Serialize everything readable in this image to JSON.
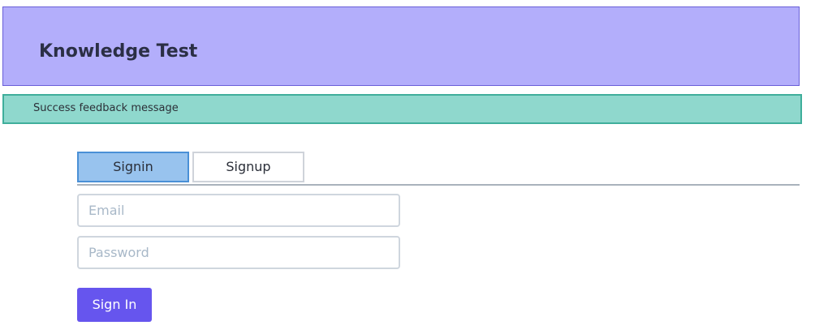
{
  "header": {
    "title": "Knowledge Test"
  },
  "alert": {
    "message": "Success feedback message",
    "type": "success",
    "color": "#8fd8cd"
  },
  "tabs": [
    {
      "label": "Signin",
      "active": true
    },
    {
      "label": "Signup",
      "active": false
    }
  ],
  "form": {
    "email": {
      "value": "",
      "placeholder": "Email"
    },
    "password": {
      "value": "",
      "placeholder": "Password"
    },
    "submit_label": "Sign In"
  },
  "colors": {
    "header_bg": "#b3aefb",
    "active_tab_bg": "#98c3ee",
    "primary_button": "#6655ee"
  }
}
